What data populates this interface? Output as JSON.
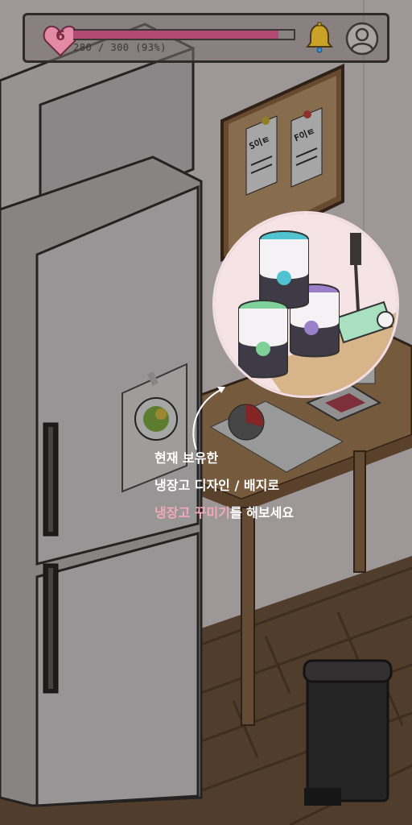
{
  "hud": {
    "level": "6",
    "hp_current": 280,
    "hp_max": 300,
    "hp_text": "280 / 300 (93%)",
    "hp_fraction": 0.93,
    "bell_icon": "bell-icon",
    "profile_icon": "user-profile-icon"
  },
  "board": {
    "note_left": "S이ㅌ",
    "note_right": "F이ㅌ"
  },
  "tutorial": {
    "line1": "현재 보유한",
    "line2": "냉장고 디자인 / 배지로",
    "line3_highlight": "냉장고 꾸미기",
    "line3_rest": "를 해보세요"
  },
  "colors": {
    "accent_pink": "#f4a9b9",
    "hp_fill": "#b34a73",
    "bell_gold": "#c9a227"
  }
}
